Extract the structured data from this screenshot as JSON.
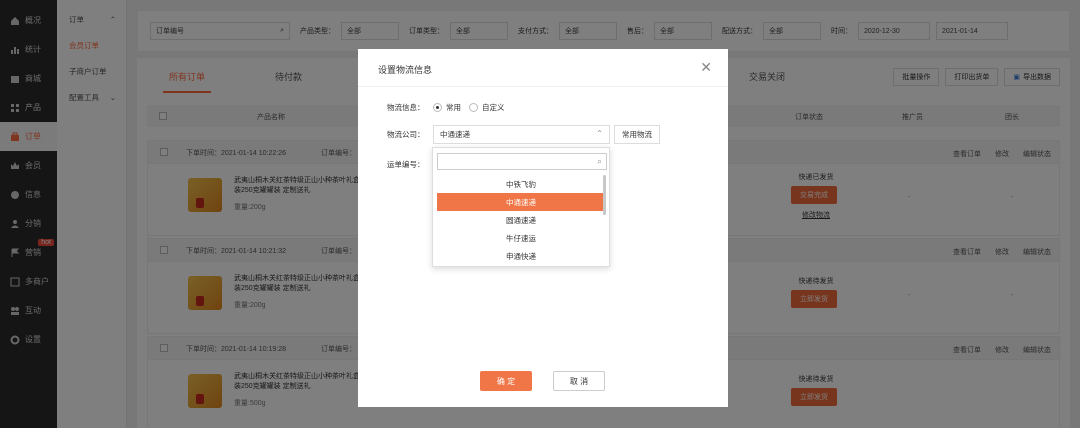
{
  "sidebar": {
    "items": [
      {
        "label": "概况",
        "icon": "home-icon"
      },
      {
        "label": "统计",
        "icon": "chart-icon"
      },
      {
        "label": "商城",
        "icon": "shop-icon"
      },
      {
        "label": "产品",
        "icon": "grid-icon"
      },
      {
        "label": "订单",
        "icon": "bag-icon"
      },
      {
        "label": "会员",
        "icon": "crown-icon"
      },
      {
        "label": "信息",
        "icon": "info-icon"
      },
      {
        "label": "分销",
        "icon": "user-icon"
      },
      {
        "label": "营销",
        "icon": "flag-icon",
        "badge": "hot"
      },
      {
        "label": "多商户",
        "icon": "store-icon"
      },
      {
        "label": "互动",
        "icon": "group-icon"
      },
      {
        "label": "设置",
        "icon": "gear-icon"
      }
    ]
  },
  "subbar": {
    "title": "订单",
    "items": [
      "会员订单",
      "子商户订单",
      "配置工具"
    ]
  },
  "filters": {
    "order_no": "订单编号",
    "product_type_label": "产品类型：",
    "product_type": "全部",
    "order_type_label": "订单类型：",
    "order_type": "全部",
    "pay_label": "支付方式：",
    "pay": "全部",
    "after_label": "售后：",
    "after": "全部",
    "delivery_label": "配送方式：",
    "delivery": "全部",
    "time_label": "时间：",
    "start": "2020-12-30",
    "end": "2021-01-14"
  },
  "tabs": [
    "所有订单",
    "待付款"
  ],
  "tab_closed": "交易关闭",
  "actions": [
    "批量操作",
    "打印出货单",
    "导出数据"
  ],
  "columns": {
    "product": "产品名称",
    "status": "订单状态",
    "promoter": "推广员",
    "group": "团长"
  },
  "orders": [
    {
      "time": "下单时间：2021-01-14 10:22:26",
      "no_label": "订单编号：",
      "name": "武夷山桐木关红茶特级正山小种茶叶礼盒装250克罐罐装 定制送礼",
      "spec": "重量:200g",
      "status": "快递已发货",
      "btn": "交易完成",
      "link": "修改物流"
    },
    {
      "time": "下单时间：2021-01-14 10:21:32",
      "no_label": "订单编号：",
      "name": "武夷山桐木关红茶特级正山小种茶叶礼盒装250克罐罐装 定制送礼",
      "spec": "重量:200g",
      "status": "快递待发货",
      "btn": "立即发货",
      "link": ""
    },
    {
      "time": "下单时间：2021-01-14 10:19:28",
      "no_label": "订单编号：",
      "name": "武夷山桐木关红茶特级正山小种茶叶礼盒装250克罐罐装 定制送礼",
      "spec": "重量:500g",
      "status": "快递待发货",
      "btn": "立即发货",
      "link": ""
    }
  ],
  "order_actions": [
    "查看订单",
    "修改",
    "编辑状态"
  ],
  "modal": {
    "title": "设置物流信息",
    "info_label": "物流信息：",
    "radio_common": "常用",
    "radio_custom": "自定义",
    "company_label": "物流公司：",
    "company_value": "中通速递",
    "common_btn": "常用物流",
    "tracking_label": "运单编号：",
    "options": [
      "中铁飞豹",
      "中通速递",
      "圆通速递",
      "牛仔速运",
      "申通快递"
    ],
    "selected_index": 1,
    "ok": "确 定",
    "cancel": "取 消"
  },
  "dash": "-"
}
